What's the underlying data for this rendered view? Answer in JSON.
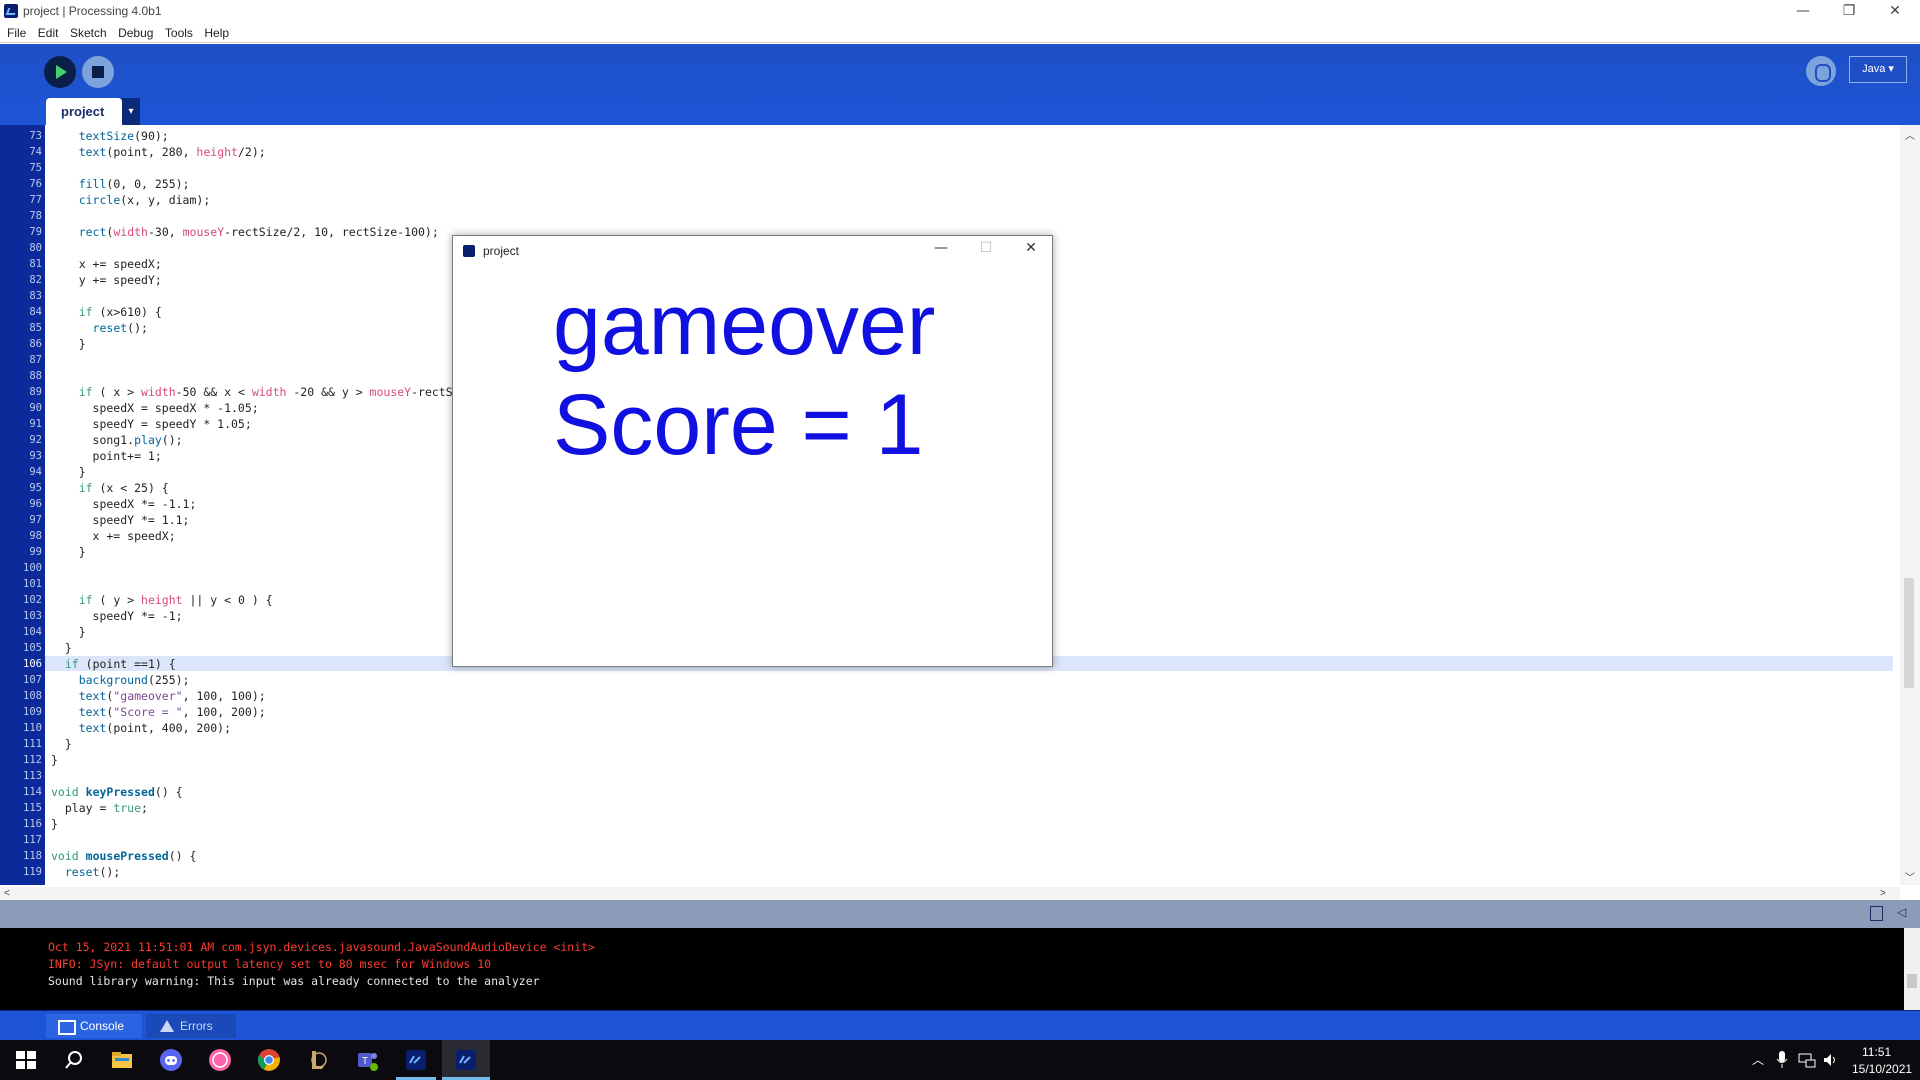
{
  "window": {
    "title": "project | Processing 4.0b1",
    "minimize": "—",
    "restore": "❐",
    "close": "✕"
  },
  "menu": [
    "File",
    "Edit",
    "Sketch",
    "Debug",
    "Tools",
    "Help"
  ],
  "toolbar": {
    "mode": "Java ▾"
  },
  "editor": {
    "tab_label": "project",
    "tab_menu": "▾",
    "current_line": 106
  },
  "code_lines": [
    {
      "n": "73",
      "t": "    textSize(90);"
    },
    {
      "n": "74",
      "t": "    text(point, 280, height/2);"
    },
    {
      "n": "75",
      "t": ""
    },
    {
      "n": "76",
      "t": "    fill(0, 0, 255);"
    },
    {
      "n": "77",
      "t": "    circle(x, y, diam);"
    },
    {
      "n": "78",
      "t": ""
    },
    {
      "n": "79",
      "t": "    rect(width-30, mouseY-rectSize/2, 10, rectSize-100);"
    },
    {
      "n": "80",
      "t": ""
    },
    {
      "n": "81",
      "t": "    x += speedX;"
    },
    {
      "n": "82",
      "t": "    y += speedY;"
    },
    {
      "n": "83",
      "t": ""
    },
    {
      "n": "84",
      "t": "    if (x>610) {"
    },
    {
      "n": "85",
      "t": "      reset();"
    },
    {
      "n": "86",
      "t": "    }"
    },
    {
      "n": "87",
      "t": ""
    },
    {
      "n": "88",
      "t": ""
    },
    {
      "n": "89",
      "t": "    if ( x > width-50 && x < width -20 && y > mouseY-rectS"
    },
    {
      "n": "90",
      "t": "      speedX = speedX * -1.05;"
    },
    {
      "n": "91",
      "t": "      speedY = speedY * 1.05;"
    },
    {
      "n": "92",
      "t": "      song1.play();"
    },
    {
      "n": "93",
      "t": "      point+= 1;"
    },
    {
      "n": "94",
      "t": "    }"
    },
    {
      "n": "95",
      "t": "    if (x < 25) {"
    },
    {
      "n": "96",
      "t": "      speedX *= -1.1;"
    },
    {
      "n": "97",
      "t": "      speedY *= 1.1;"
    },
    {
      "n": "98",
      "t": "      x += speedX;"
    },
    {
      "n": "99",
      "t": "    }"
    },
    {
      "n": "100",
      "t": ""
    },
    {
      "n": "101",
      "t": ""
    },
    {
      "n": "102",
      "t": "    if ( y > height || y < 0 ) {"
    },
    {
      "n": "103",
      "t": "      speedY *= -1;"
    },
    {
      "n": "104",
      "t": "    }"
    },
    {
      "n": "105",
      "t": "  }"
    },
    {
      "n": "106",
      "t": "  if (point ==1) {"
    },
    {
      "n": "107",
      "t": "    background(255);"
    },
    {
      "n": "108",
      "t": "    text(\"gameover\", 100, 100);"
    },
    {
      "n": "109",
      "t": "    text(\"Score = \", 100, 200);"
    },
    {
      "n": "110",
      "t": "    text(point, 400, 200);"
    },
    {
      "n": "111",
      "t": "  }"
    },
    {
      "n": "112",
      "t": "}"
    },
    {
      "n": "113",
      "t": ""
    },
    {
      "n": "114",
      "t": "void keyPressed() {"
    },
    {
      "n": "115",
      "t": "  play = true;"
    },
    {
      "n": "116",
      "t": "}"
    },
    {
      "n": "117",
      "t": ""
    },
    {
      "n": "118",
      "t": "void mousePressed() {"
    },
    {
      "n": "119",
      "t": "  reset();"
    }
  ],
  "console": {
    "lines": [
      {
        "text": "Oct 15, 2021 11:51:01 AM com.jsyn.devices.javasound.JavaSoundAudioDevice <init>",
        "color": "#ff3b2f"
      },
      {
        "text": "INFO: JSyn: default output latency set to 80 msec for Windows 10",
        "color": "#ff3b2f"
      },
      {
        "text": "Sound library warning: This input was already connected to the analyzer",
        "color": "#e6e6e6"
      }
    ],
    "tabs": [
      "Console",
      "Errors"
    ]
  },
  "sketch_window": {
    "title": "project",
    "line1": "gameover",
    "line2": "Score = 1",
    "text_color": "#1010e0"
  },
  "taskbar": {
    "icons": [
      "windows-start-icon",
      "search-icon",
      "file-explorer-icon",
      "discord-icon",
      "osu-icon",
      "chrome-icon",
      "league-of-legends-icon",
      "teams-icon",
      "processing-icon",
      "processing-active-icon"
    ],
    "time": "11:51",
    "date": "15/10/2021"
  },
  "colors": {
    "toolbar_blue": "#1d55d6",
    "gutter_blue": "#0d2a9a",
    "keyword_green": "#33997e",
    "function_blue": "#006699",
    "system_pink": "#d94a7a"
  }
}
